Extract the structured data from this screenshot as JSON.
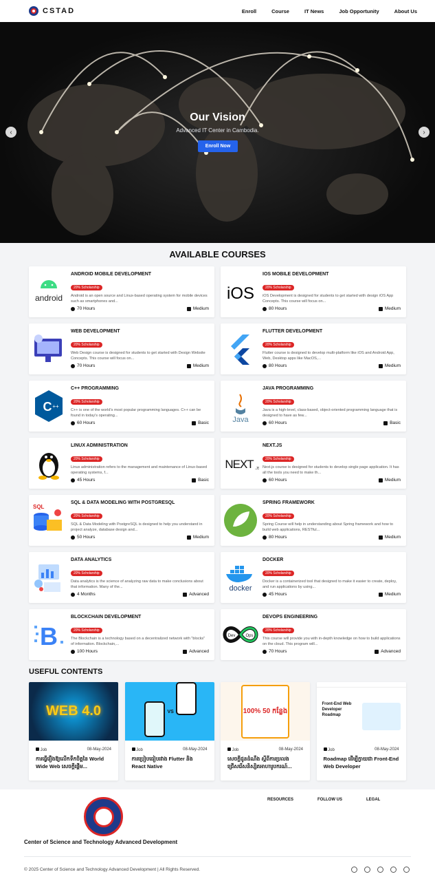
{
  "brand": {
    "name": "CSTAD"
  },
  "nav": [
    "Enroll",
    "Course",
    "IT News",
    "Job Opportunity",
    "About Us"
  ],
  "hero": {
    "title": "Our Vision",
    "subtitle": "Advanced IT Center in Cambodia.",
    "button": "Enroll Now"
  },
  "courses_title": "AVAILABLE COURSES",
  "courses": [
    {
      "title": "ANDROID MOBILE DEVELOPMENT",
      "badge": "20% Scholarship",
      "desc": "Android is an open source and Linux-based operating system for mobile devices such as smartphones and...",
      "duration": "70 Hours",
      "level": "Medium",
      "icon": "android-logo"
    },
    {
      "title": "IOS MOBILE DEVELOPMENT",
      "badge": "20% Scholarship",
      "desc": "iOS Development is designed for students to get started with design iOS App Concepts. This course will focus on...",
      "duration": "80 Hours",
      "level": "Medium",
      "icon": "ios-logo"
    },
    {
      "title": "WEB DEVELOPMENT",
      "badge": "20% Scholarship",
      "desc": "Web Design course is designed for students to get started with Design Website Concepts. This course will focus on...",
      "duration": "70 Hours",
      "level": "Medium",
      "icon": "web-illustration"
    },
    {
      "title": "FLUTTER DEVELOPMENT",
      "badge": "20% Scholarship",
      "desc": "Flutter course is designed to develop multi-platform like iOS and Android App, Web, Desktop apps like MacOS,...",
      "duration": "80 Hours",
      "level": "Medium",
      "icon": "flutter-logo"
    },
    {
      "title": "C++ PROGRAMMING",
      "badge": "20% Scholarship",
      "desc": "C++ is one of the world's most popular programming languages. C++ can be found in today's operating...",
      "duration": "60 Hours",
      "level": "Basic",
      "icon": "cpp-logo"
    },
    {
      "title": "JAVA PROGRAMMING",
      "badge": "20% Scholarship",
      "desc": "Java is a high-level, class-based, object-oriented programming language that is designed to have as few...",
      "duration": "60 Hours",
      "level": "Basic",
      "icon": "java-logo"
    },
    {
      "title": "LINUX ADMINISTRATION",
      "badge": "20% Scholarship",
      "desc": "Linux administration refers to the management and maintenance of Linux-based operating systems, f...",
      "duration": "45 Hours",
      "level": "Basic",
      "icon": "linux-logo"
    },
    {
      "title": "NEXT.JS",
      "badge": "20% Scholarship",
      "desc": "Next.js course is designed for students to develop single page application. It has all the tools you need to make th...",
      "duration": "60 Hours",
      "level": "Medium",
      "icon": "nextjs-logo"
    },
    {
      "title": "SQL & DATA MODELING WITH POSTGRESQL",
      "badge": "20% Scholarship",
      "desc": "SQL & Data Modeling with PostgreSQL is designed to help you understand in project analyze, database design and...",
      "duration": "50 Hours",
      "level": "Medium",
      "icon": "sql-illustration"
    },
    {
      "title": "SPRING FRAMEWORK",
      "badge": "20% Scholarship",
      "desc": "Spring Course will help in understanding about Spring framework and how to build web applications, RESTful...",
      "duration": "80 Hours",
      "level": "Medium",
      "icon": "spring-logo"
    },
    {
      "title": "DATA ANALYTICS",
      "badge": "20% Scholarship",
      "desc": "Data analytics is the science of analyzing raw data to make conclusions about that information. Many of the...",
      "duration": "4 Months",
      "level": "Advanced",
      "icon": "analytics-illustration"
    },
    {
      "title": "DOCKER",
      "badge": "20% Scholarship",
      "desc": "Docker is a containerized tool that designed to make it easier to create, deploy, and run applications by using...",
      "duration": "45 Hours",
      "level": "Medium",
      "icon": "docker-logo"
    },
    {
      "title": "BLOCKCHAIN DEVELOPMENT",
      "badge": "20% Scholarship",
      "desc": "The Blockchain is a technology based on a decentralized network with \"blocks\" of information. Blockchain,...",
      "duration": "100 Hours",
      "level": "Advanced",
      "icon": "blockchain-logo"
    },
    {
      "title": "DEVOPS ENGINEERING",
      "badge": "20% Scholarship",
      "desc": "This course will provide you with in-depth knowledge on how to build applications on the cloud. This program will...",
      "duration": "70 Hours",
      "level": "Advanced",
      "icon": "devops-logo"
    }
  ],
  "useful_title": "USEFUL CONTENTS",
  "useful": [
    {
      "tag": "Job",
      "date": "08-May-2024",
      "title": "ការធ្វើរឿងឱ្យលើកទឹកចិត្តនៃ World Wide Web សេចក្តីផ្តើម...",
      "img_text": "WEB 4.0"
    },
    {
      "tag": "Job",
      "date": "08-May-2024",
      "title": "ការប្រៀបធៀបរវាង Flutter និង React Native",
      "img_text": "VS"
    },
    {
      "tag": "Job",
      "date": "08-May-2024",
      "title": "សេចក្តីជូនដំណឹង ស្តីពីការប្រលងជ្រើសរើសនិស្សិតអាហារូបករណ៍...",
      "img_text": "100% 50 កន្លែង"
    },
    {
      "tag": "Job",
      "date": "08-May-2024",
      "title": "Roadmap ដើម្បីក្លាយជា Front-End Web Developer",
      "img_text": "Front-End Web Developer Roadmap"
    }
  ],
  "footer": {
    "org_name": "Center of Science and Technology Advanced Development",
    "cols": [
      "RESOURCES",
      "FOLLOW US",
      "LEGAL"
    ],
    "copyright": "© 2025 Center of Science and Technology Advanced Development | All Rights Reserved.",
    "socials": [
      "facebook-icon",
      "instagram-icon",
      "twitter-icon",
      "github-icon",
      "dribbble-icon"
    ]
  }
}
